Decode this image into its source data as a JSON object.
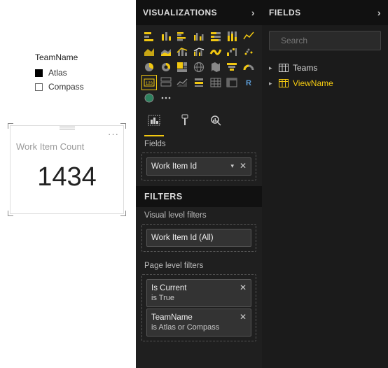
{
  "canvas": {
    "legend": {
      "title": "TeamName",
      "items": [
        "Atlas",
        "Compass"
      ]
    },
    "card": {
      "title": "Work Item Count",
      "value": "1434"
    }
  },
  "viz_panel": {
    "title": "VISUALIZATIONS",
    "fields_section": {
      "label": "Fields",
      "field_pill": "Work Item Id"
    },
    "filters_header": "FILTERS",
    "visual_filters": {
      "label": "Visual level filters",
      "pill": "Work Item Id  (All)"
    },
    "page_filters": {
      "label": "Page level filters",
      "items": [
        {
          "name": "Is Current",
          "cond": "is True"
        },
        {
          "name": "TeamName",
          "cond": "is Atlas or Compass"
        }
      ]
    }
  },
  "fields_panel": {
    "title": "FIELDS",
    "search_placeholder": "Search",
    "tables": [
      {
        "name": "Teams",
        "highlight": false
      },
      {
        "name": "ViewName",
        "highlight": true
      }
    ]
  },
  "chart_data": {
    "type": "table",
    "title": "Work Item Count",
    "value": 1434,
    "field": "Work Item Id",
    "aggregation": "count",
    "filters": {
      "Is Current": "True",
      "TeamName": [
        "Atlas",
        "Compass"
      ]
    }
  }
}
